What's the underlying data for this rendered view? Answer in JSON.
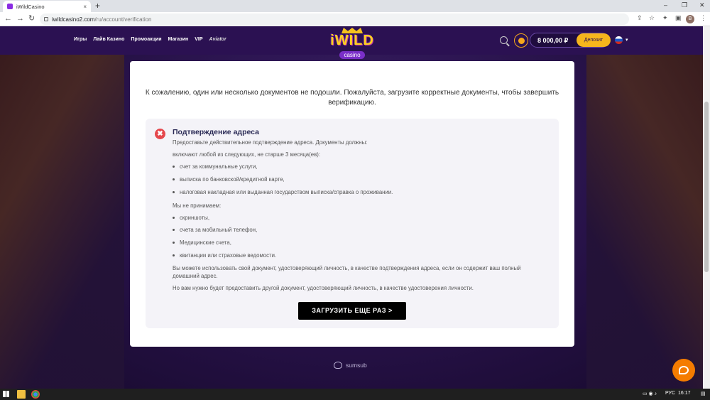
{
  "browser": {
    "tab_title": "iWildCasino",
    "tab_close": "×",
    "new_tab": "+",
    "url_host": "iwildcasino2.com",
    "url_path": "/ru/account/verification",
    "win_min": "–",
    "win_max": "❐",
    "win_close": "✕",
    "back": "←",
    "forward": "→",
    "reload": "↻",
    "profile_initial": "B"
  },
  "header": {
    "nav": [
      "Игры",
      "Лайв Казино",
      "Промоакции",
      "Магазин",
      "VIP",
      "Aviator"
    ],
    "logo_text": "iWILD",
    "logo_sub": "casino",
    "balance": "8 000,00 ₽",
    "deposit_label": "Депозит",
    "language_caret": "▾"
  },
  "verification": {
    "notice": "К сожалению, один или несколько документов не подошли. Пожалуйста, загрузите корректные документы, чтобы завершить верификацию.",
    "error_icon": "✖",
    "title": "Подтверждение адреса",
    "intro": "Предоставьте действительное подтверждение адреса. Документы должны:",
    "includes": "включают любой из следующих, не старше 3 месяца(ев):",
    "accepted": [
      "счет за коммунальные услуги,",
      "выписка по банковской/кредитной карте,",
      "налоговая накладная или выданная государством выписка/справка о проживании."
    ],
    "not_accepted_title": "Мы не принимаем:",
    "not_accepted": [
      "скриншоты,",
      "счета за мобильный телефон,",
      "Медицинские счета,",
      "квитанции или страховые ведомости."
    ],
    "note1": "Вы можете использовать свой документ, удостоверяющий личность, в качестве подтверждения адреса, если он содержит ваш полный домашний адрес.",
    "note2": "Но вам нужно будет предоставить другой документ, удостоверяющий личность, в качестве удостоверения личности.",
    "upload_button": "ЗАГРУЗИТЬ ЕЩЕ РАЗ   >"
  },
  "footer": {
    "sumsub": "sumsub"
  },
  "taskbar": {
    "lang": "РУС",
    "time": "16:17"
  },
  "colors": {
    "header_bg": "#2b1152",
    "accent": "#f6b61c",
    "error": "#e5484d"
  }
}
